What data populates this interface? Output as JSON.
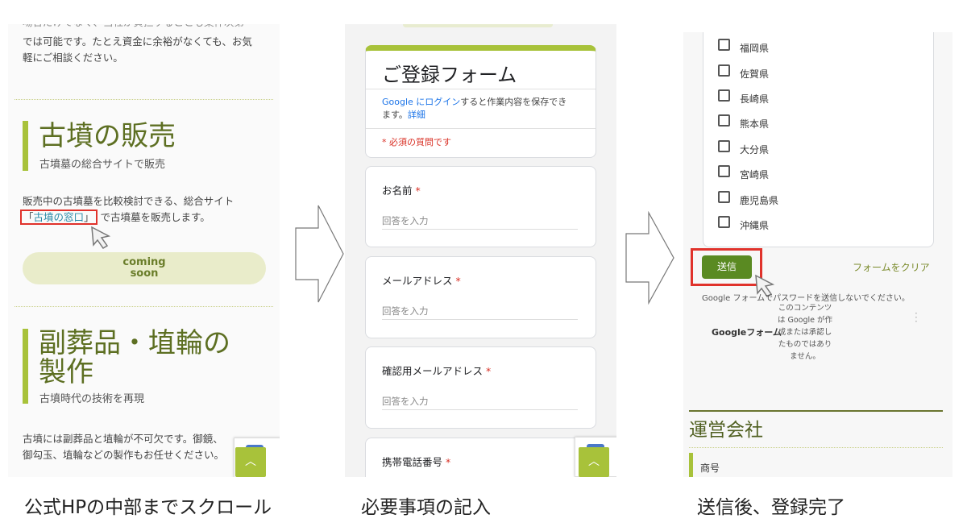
{
  "panel1": {
    "cut_line": "場合だけでなく、当社が負担することも案件次第",
    "intro_lines": [
      "では可能です。たとえ資金に余裕がなくても、お気",
      "軽にご相談ください。"
    ],
    "section1": {
      "title": "古墳の販売",
      "subtitle": "古墳墓の総合サイトで販売",
      "body_line1": "販売中の古墳墓を比較検討できる、総合サイト",
      "link_open": "「",
      "link_text": "古墳の窓口",
      "link_close": "」",
      "body_line2_rest": "で古墳墓を販売します。",
      "button_line1": "coming",
      "button_line2": "soon"
    },
    "section2": {
      "title_line1": "副葬品・埴輪の",
      "title_line2": "製作",
      "subtitle": "古墳時代の技術を再現",
      "body_lines": [
        "古墳には副葬品と埴輪が不可欠です。御鏡、",
        "御勾玉、埴輪などの製作もお任せください。"
      ]
    },
    "scroll_top_icon": "chevron-up-icon"
  },
  "panel2": {
    "form_title": "ご登録フォーム",
    "login_link": "Google にログイン",
    "login_text": "すると作業内容を保存でき",
    "login_text2": "ます。",
    "details_link": "詳細",
    "required_note": "* 必須の質問です",
    "questions": [
      {
        "label": "お名前",
        "required": "*",
        "placeholder": "回答を入力"
      },
      {
        "label": "メールアドレス",
        "required": "*",
        "placeholder": "回答を入力"
      },
      {
        "label": "確認用メールアドレス",
        "required": "*",
        "placeholder": "回答を入力"
      },
      {
        "label": "携帯電話番号",
        "required": "*"
      }
    ]
  },
  "panel3": {
    "prefectures": [
      "福岡県",
      "佐賀県",
      "長崎県",
      "熊本県",
      "大分県",
      "宮崎県",
      "鹿児島県",
      "沖縄県"
    ],
    "submit_label": "送信",
    "clear_label": "フォームをクリア",
    "password_warning": "Google フォームでパスワードを送信しないでください。",
    "google_forms_logo": "Googleフォーム",
    "disclaimer_lines": [
      "このコンテンツ",
      "は Google が作",
      "成または承認し",
      "たものではあり",
      "ません。"
    ],
    "company_heading": "運営会社",
    "company_item": "商号"
  },
  "captions": [
    "公式HPの中部までスクロール",
    "必要事項の記入",
    "送信後、登録完了"
  ],
  "colors": {
    "accent_green": "#a8c23a",
    "heading_olive": "#5d6f22",
    "submit_green": "#5a8a22",
    "highlight_red": "#e0322b"
  }
}
